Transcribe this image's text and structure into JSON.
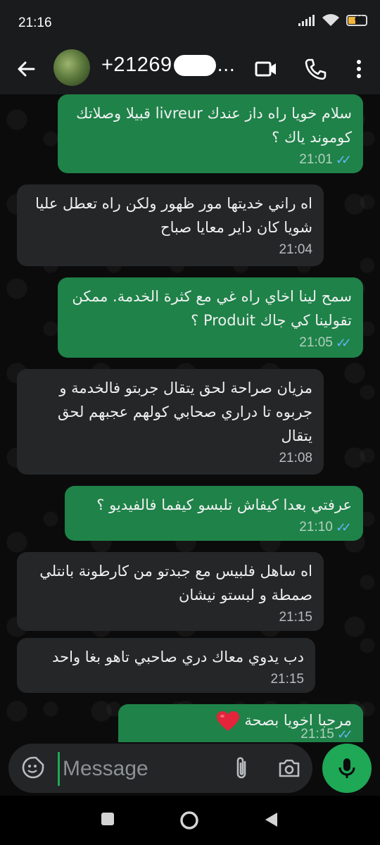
{
  "status_bar": {
    "time": "21:16",
    "battery_level": "41",
    "battery_fraction": 0.41
  },
  "header": {
    "contact_prefix": "+21269",
    "contact_suffix": "..."
  },
  "messages": [
    {
      "direction": "out",
      "text": "سلام خويا راه داز عندك livreur قبيلا وصلاتك كوموند ياك ؟",
      "time": "21:01",
      "status": "read"
    },
    {
      "direction": "in",
      "text": "اه راني خديتها مور ظهور ولكن راه تعطل عليا شويا كان داير معايا صباح",
      "time": "21:04"
    },
    {
      "direction": "out",
      "text": "سمح لينا اخاي راه غي مع كثرة الخدمة. ممكن تقولينا كي جاك Produit ؟",
      "time": "21:05",
      "status": "read"
    },
    {
      "direction": "in",
      "text": "مزيان صراحة لحق يتقال جربتو فالخدمة و جربوه تا دراري صحابي كولهم عجبهم لحق يتقال",
      "time": "21:08"
    },
    {
      "direction": "out",
      "text": "عرفتي بعدا كيفاش تلبسو كيفما فالفيديو ؟",
      "time": "21:10",
      "status": "read"
    },
    {
      "direction": "in",
      "text": "اه ساهل فلبيس مع جبدتو من كارطونة بانتلي صمطة و لبستو نيشان",
      "time": "21:15"
    },
    {
      "direction": "in",
      "text": "دب يدوي معاك دري صاحبي تاهو بغا واحد",
      "time": "21:15"
    },
    {
      "direction": "out",
      "text": "مرحبا اخويا بصحة",
      "time": "21:15",
      "status": "read",
      "emoji": "red-heart"
    }
  ],
  "composer": {
    "placeholder": "Message"
  },
  "colors": {
    "outgoing": "#1f8248",
    "incoming": "#242628",
    "accent": "#1fa855",
    "read_ticks": "#5fb6f2"
  },
  "icons": {
    "app_bar": [
      "back-arrow-icon",
      "video-call-icon",
      "voice-call-icon",
      "more-vert-icon"
    ],
    "composer": [
      "emoji-icon",
      "attach-icon",
      "camera-icon",
      "mic-icon"
    ],
    "nav": [
      "nav-back-icon",
      "nav-home-icon",
      "nav-recents-icon"
    ]
  }
}
